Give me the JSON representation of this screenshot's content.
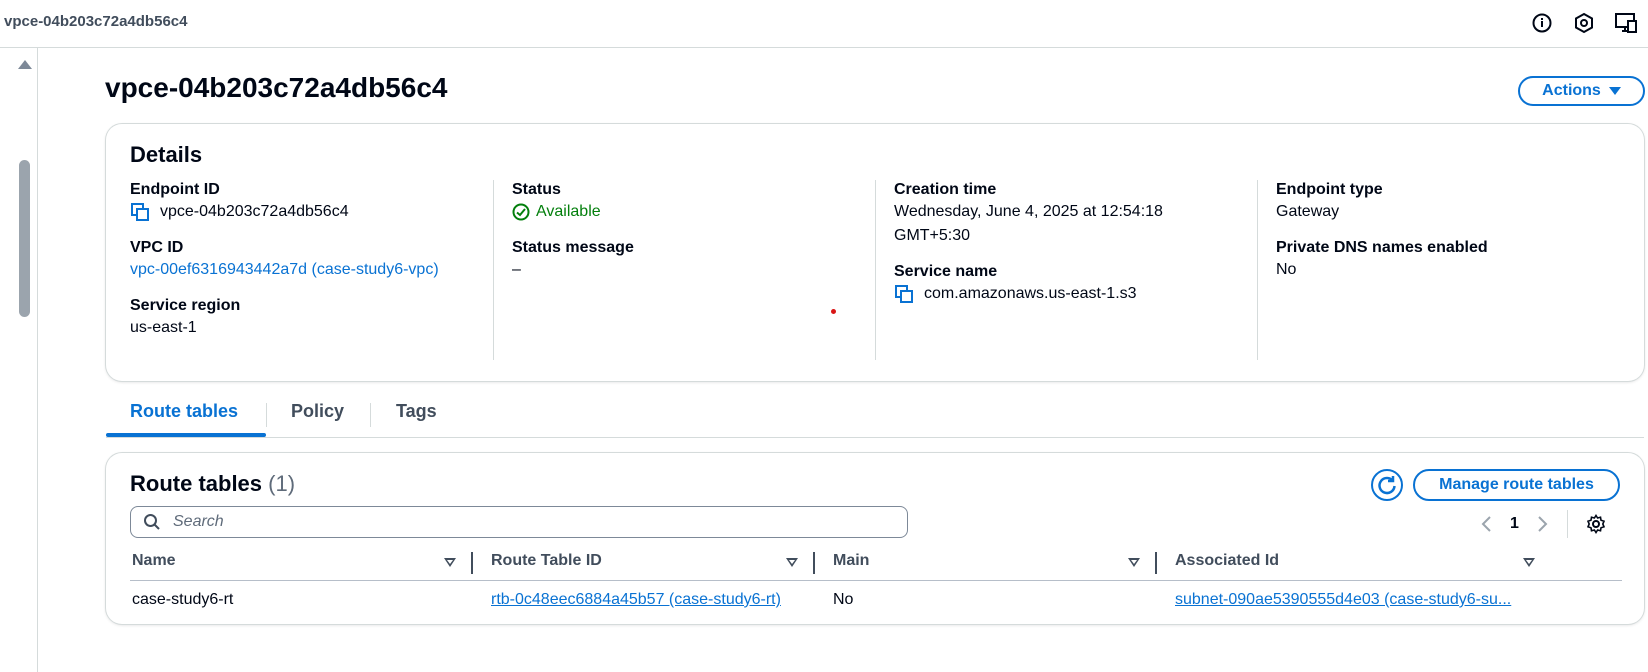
{
  "topbar": {
    "breadcrumb": "vpce-04b203c72a4db56c4",
    "icons": [
      "info-icon",
      "feedback-icon",
      "display-settings-icon"
    ]
  },
  "page": {
    "title": "vpce-04b203c72a4db56c4",
    "actions_label": "Actions"
  },
  "details": {
    "title": "Details",
    "endpoint_id_label": "Endpoint ID",
    "endpoint_id": "vpce-04b203c72a4db56c4",
    "vpc_id_label": "VPC ID",
    "vpc_id": "vpc-00ef6316943442a7d (case-study6-vpc)",
    "service_region_label": "Service region",
    "service_region": "us-east-1",
    "status_label": "Status",
    "status": "Available",
    "status_message_label": "Status message",
    "status_message": "–",
    "creation_time_label": "Creation time",
    "creation_time_line1": "Wednesday, June 4, 2025 at 12:54:18",
    "creation_time_line2": "GMT+5:30",
    "service_name_label": "Service name",
    "service_name": "com.amazonaws.us-east-1.s3",
    "endpoint_type_label": "Endpoint type",
    "endpoint_type": "Gateway",
    "private_dns_label": "Private DNS names enabled",
    "private_dns": "No"
  },
  "tabs": [
    {
      "label": "Route tables",
      "active": true
    },
    {
      "label": "Policy",
      "active": false
    },
    {
      "label": "Tags",
      "active": false
    }
  ],
  "route_tables": {
    "title": "Route tables",
    "count": "(1)",
    "manage_label": "Manage route tables",
    "search_placeholder": "Search",
    "page_number": "1",
    "columns": [
      "Name",
      "Route Table ID",
      "Main",
      "Associated Id"
    ],
    "rows": [
      {
        "name": "case-study6-rt",
        "route_table_id": "rtb-0c48eec6884a45b57 (case-study6-rt)",
        "main": "No",
        "associated_id": "subnet-090ae5390555d4e03 (case-study6-su..."
      }
    ]
  },
  "colors": {
    "accent": "#0972d3",
    "success": "#037f0c",
    "text": "#000716",
    "border": "#d5dbdb"
  }
}
